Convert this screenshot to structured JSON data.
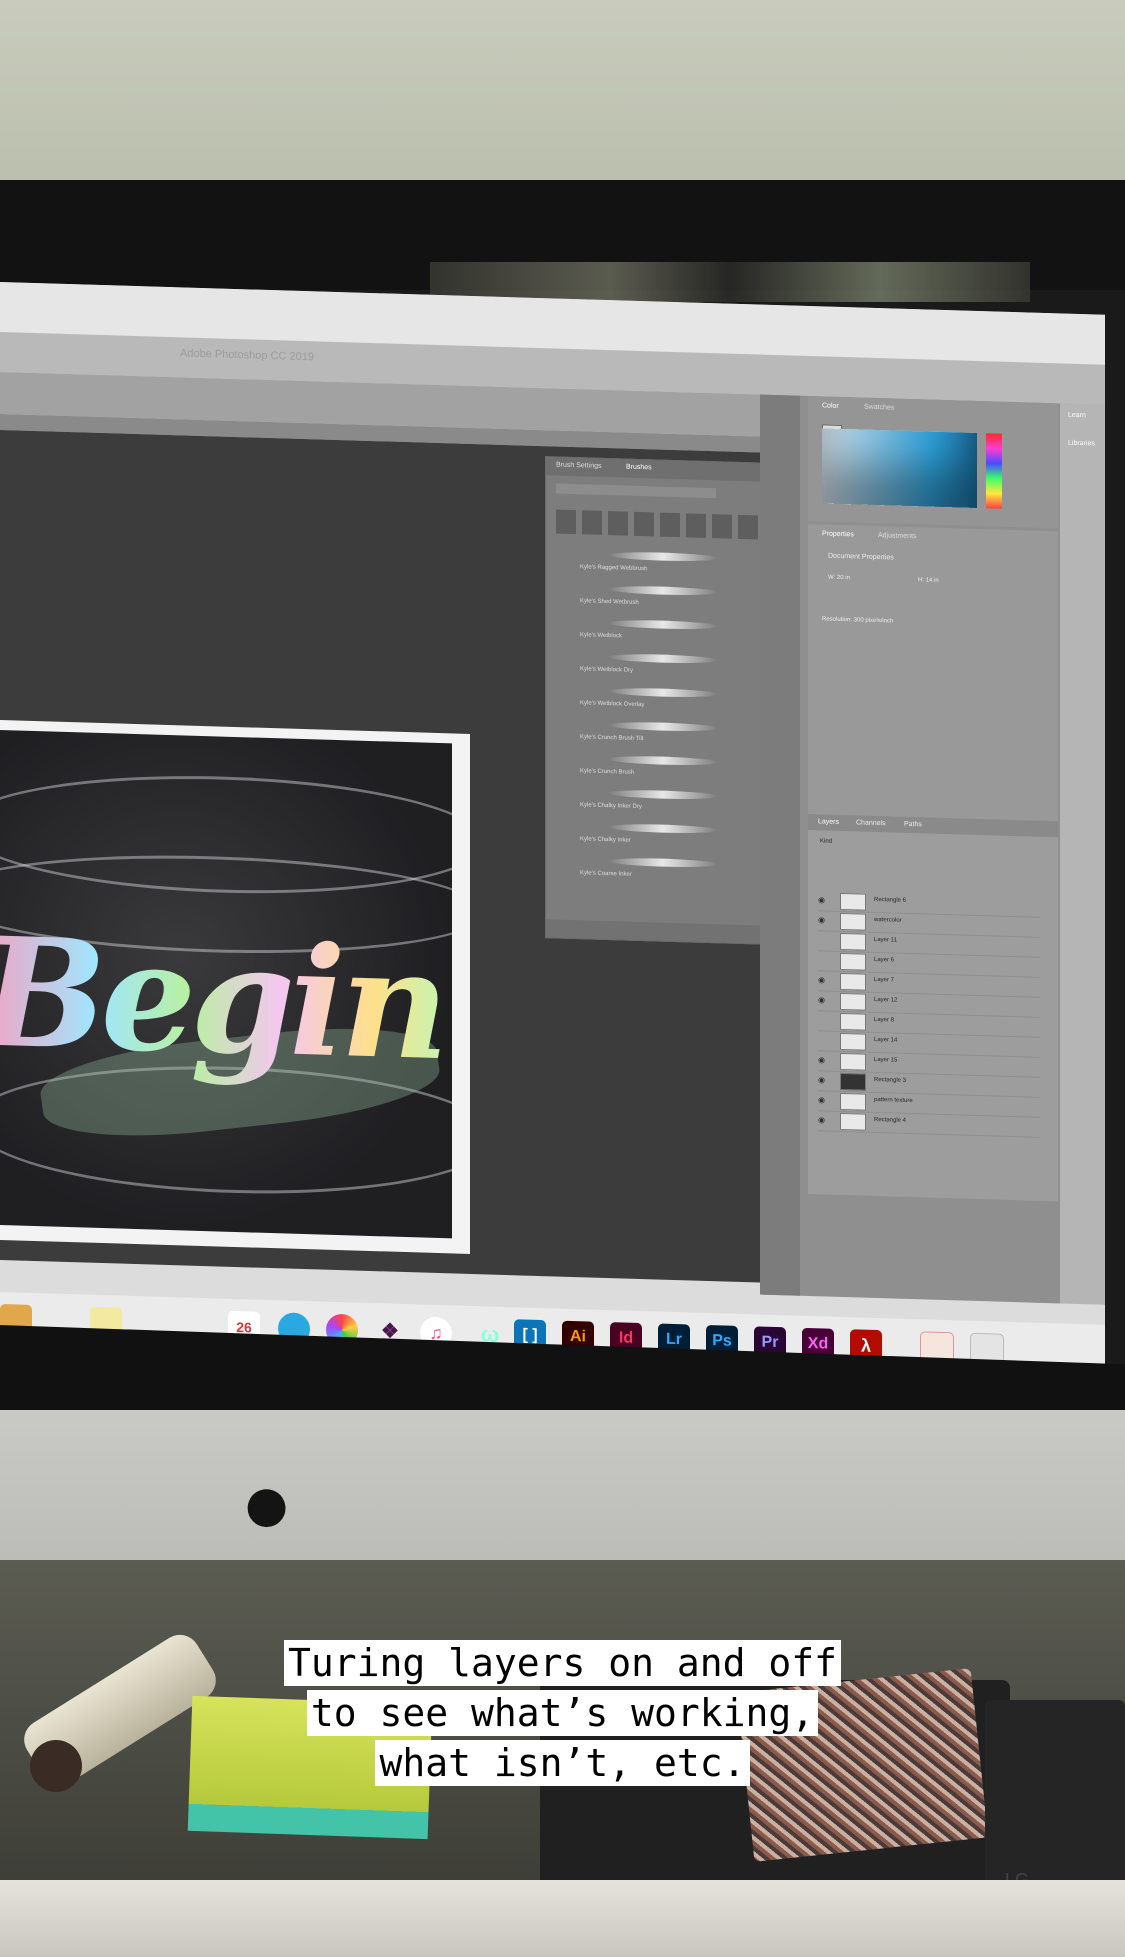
{
  "app": {
    "title": "Adobe Photoshop CC 2019"
  },
  "canvas": {
    "artwork_text": "Begin"
  },
  "brushes_panel": {
    "tabs": [
      "Brush Settings",
      "Brushes"
    ],
    "brushes": [
      "Kyle's Ragged Webbrush",
      "Kyle's Shed Wetbrush",
      "Kyle's Wetblock",
      "Kyle's Wetblock Dry",
      "Kyle's Wetblock Overlay",
      "Kyle's Crunch Brush Tilt",
      "Kyle's Crunch Brush",
      "Kyle's Chalky Inker Dry",
      "Kyle's Chalky Inker",
      "Kyle's Coarse Inker"
    ]
  },
  "color_panel": {
    "tabs": [
      "Color",
      "Swatches"
    ]
  },
  "properties_panel": {
    "tabs": [
      "Properties",
      "Adjustments"
    ],
    "section_title": "Document Properties",
    "width": "W: 20 in",
    "height": "H: 14 in",
    "resolution": "Resolution: 300 pixels/inch"
  },
  "layers_panel": {
    "tabs": [
      "Layers",
      "Channels",
      "Paths"
    ],
    "filter": "Kind",
    "layers": [
      "Rectangle 6",
      "watercolor",
      "Layer 11",
      "Layer 6",
      "Layer 7",
      "Layer 12",
      "Layer 8",
      "Layer 14",
      "Layer 15",
      "Rectangle 3",
      "pattern texture",
      "Rectangle 4"
    ]
  },
  "side_panels": {
    "learn": "Learn",
    "libraries": "Libraries"
  },
  "dock": {
    "apps": [
      "Ai",
      "Id",
      "Lr",
      "Ps",
      "Pr",
      "Xd"
    ],
    "calendar_date": "26",
    "colors": {
      "Ai": "#ff9a00",
      "Id": "#ff3366",
      "Lr": "#31a8ff",
      "Ps": "#31a8ff",
      "Pr": "#9999ff",
      "Xd": "#ff61f6"
    }
  },
  "caption": {
    "lines": [
      "Turing layers on and off",
      "to see what’s working,",
      "what isn’t, etc."
    ]
  },
  "brand": {
    "monitor_logo": "apple-logo",
    "hdd_label": "LG"
  }
}
